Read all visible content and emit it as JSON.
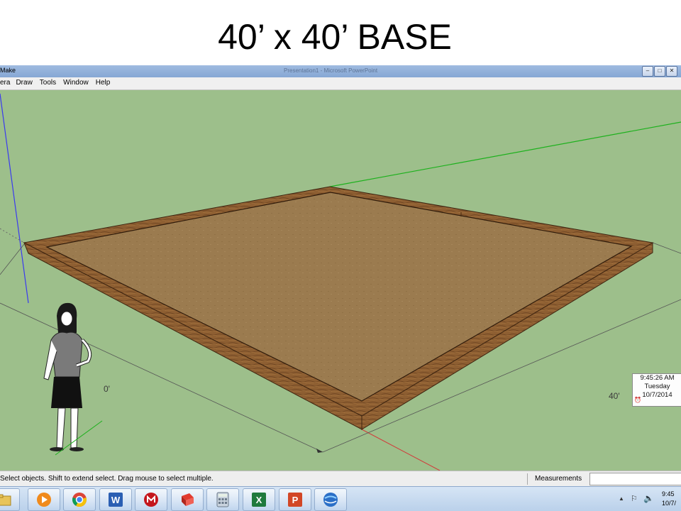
{
  "slide": {
    "title": "40’ x 40’ BASE"
  },
  "window": {
    "app_title": "Make",
    "doc_title": "Presentation1 - Microsoft PowerPoint",
    "buttons": {
      "minimize": "–",
      "maximize": "□",
      "close": "✕"
    }
  },
  "menubar": {
    "items": [
      "era",
      "Draw",
      "Tools",
      "Window",
      "Help"
    ]
  },
  "viewport": {
    "dimension_labels": {
      "near": "0'",
      "right": "40'"
    },
    "colors": {
      "ground": "#9dbf8b",
      "floor": "#9a7a4e",
      "frame": "#8a5a2e",
      "frame_dark": "#5a3618"
    }
  },
  "clock_popup": {
    "time": "9:45:26 AM",
    "day": "Tuesday",
    "date": "10/7/2014"
  },
  "statusbar": {
    "hint": "Select objects. Shift to extend select. Drag mouse to select multiple.",
    "measurements_label": "Measurements",
    "measurements_value": ""
  },
  "taskbar": {
    "apps": [
      {
        "name": "windows-explorer-icon"
      },
      {
        "name": "media-player-icon"
      },
      {
        "name": "chrome-icon"
      },
      {
        "name": "word-icon",
        "letter": "W"
      },
      {
        "name": "mcafee-icon"
      },
      {
        "name": "sketchup-icon"
      },
      {
        "name": "calculator-icon"
      },
      {
        "name": "excel-icon",
        "letter": "X"
      },
      {
        "name": "powerpoint-icon",
        "letter": "P"
      },
      {
        "name": "google-earth-icon"
      }
    ],
    "tray": {
      "time": "9:45",
      "date": "10/7/"
    }
  }
}
